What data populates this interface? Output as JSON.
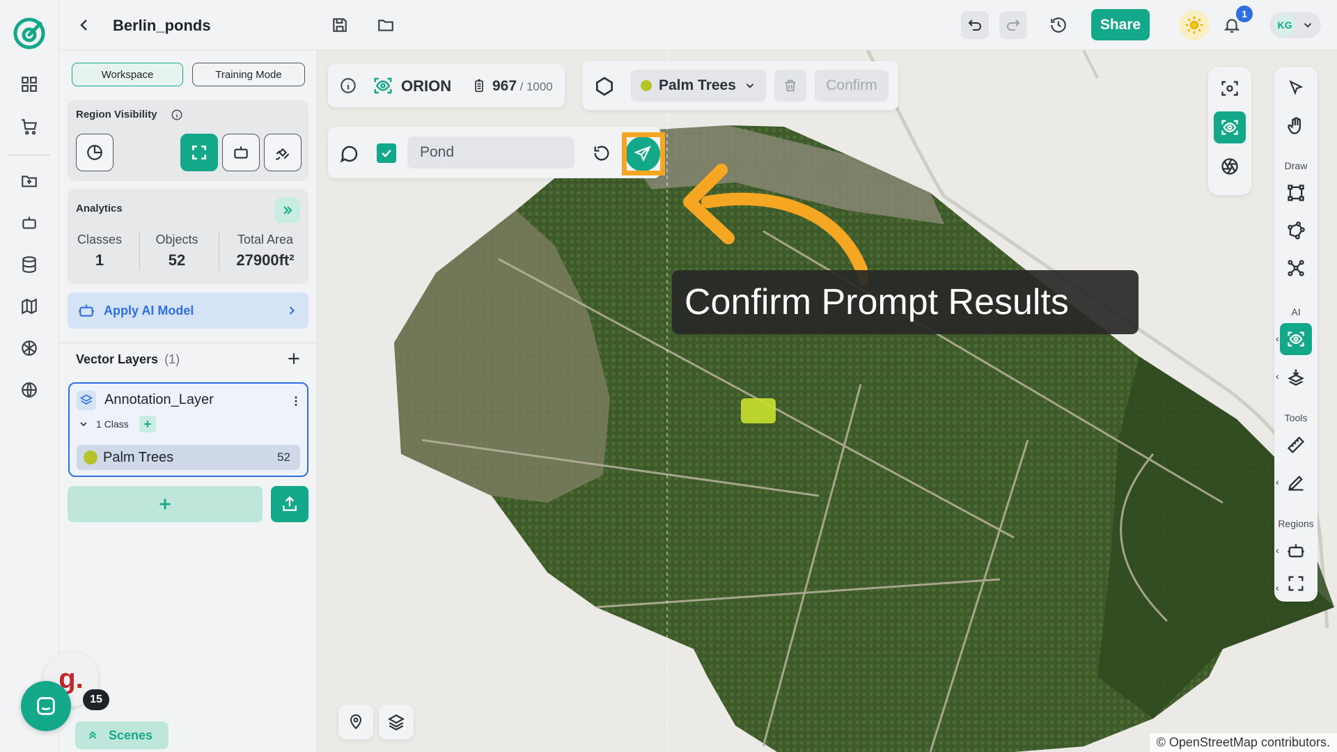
{
  "app": {
    "project_title": "Berlin_ponds",
    "share_label": "Share",
    "notifications_count": "1",
    "user_initials": "KG"
  },
  "sidebar_rail": {
    "icons": [
      "dashboard-icon",
      "cart-icon",
      "folder-icon",
      "robot-icon",
      "database-icon",
      "map-icon",
      "globe-grid-icon",
      "globe-icon"
    ]
  },
  "panel": {
    "workspace_label": "Workspace",
    "training_label": "Training Mode",
    "region_visibility_label": "Region Visibility",
    "analytics_label": "Analytics",
    "stats": [
      {
        "label": "Classes",
        "value": "1"
      },
      {
        "label": "Objects",
        "value": "52"
      },
      {
        "label": "Total Area",
        "value": "27900ft²"
      }
    ],
    "apply_ai_label": "Apply AI Model",
    "vector_layers_label": "Vector Layers",
    "vector_layers_count": "(1)",
    "layer_name": "Annotation_Layer",
    "class_count_label": "1 Class",
    "class_name": "Palm Trees",
    "class_count": "52",
    "class_color": "#b5c428"
  },
  "toolbar": {
    "model_name": "ORION",
    "credits_used": "967",
    "credits_total": "/ 1000",
    "class_select": "Palm Trees",
    "confirm_label": "Confirm",
    "prompt_value": "Pond"
  },
  "tools": {
    "draw_label": "Draw",
    "ai_label": "AI",
    "tools_label": "Tools",
    "regions_label": "Regions"
  },
  "overlay": {
    "tooltip_text": "Confirm Prompt Results",
    "highlight_color": "#f5a623"
  },
  "widgets": {
    "chat_badge_count": "15",
    "scenes_label": "Scenes",
    "map_credits": "© OpenStreetMap contributors."
  },
  "colors": {
    "accent": "#14a88a",
    "blue": "#2f6fe0"
  }
}
